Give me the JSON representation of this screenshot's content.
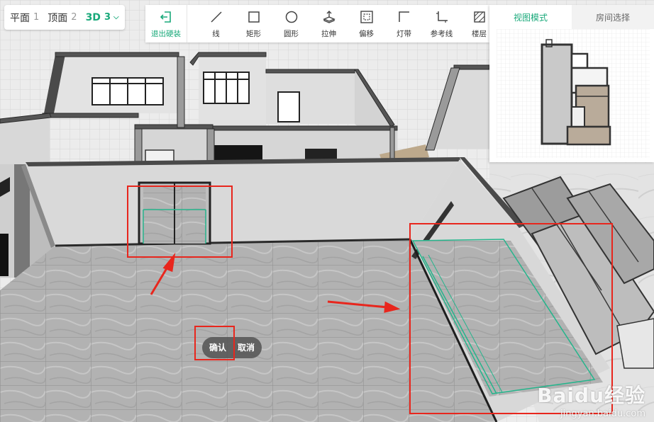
{
  "view_tabs": [
    {
      "label": "平面",
      "num": "1"
    },
    {
      "label": "顶面",
      "num": "2"
    },
    {
      "label": "3D",
      "num": "3"
    }
  ],
  "toolbar": {
    "exit": "退出硬装",
    "tools": [
      "线",
      "矩形",
      "圆形",
      "拉伸",
      "偏移",
      "灯带",
      "参考线",
      "楼层"
    ]
  },
  "panel": {
    "tabs": [
      "视图模式",
      "房间选择"
    ]
  },
  "actions": {
    "confirm": "确认",
    "cancel": "取消"
  },
  "watermark": {
    "logo": "Baidu经验",
    "url": "jingyan.baidu.com"
  },
  "colors": {
    "accent": "#19a97a",
    "annotation": "#e8261d"
  }
}
